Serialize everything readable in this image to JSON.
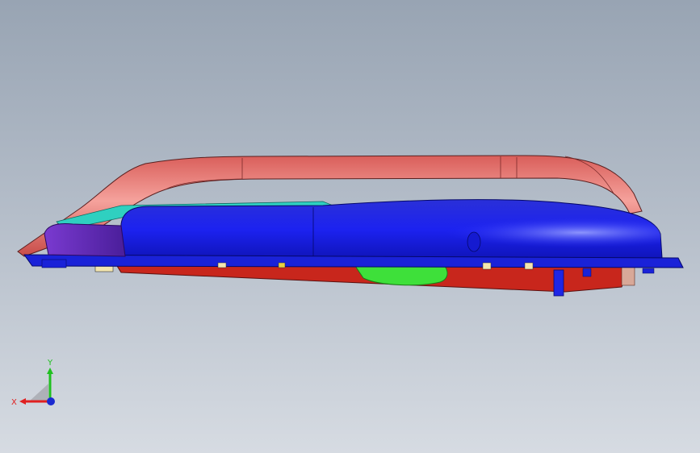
{
  "viewport": {
    "background_top": "#98a4b3",
    "background_bottom": "#d6dbe2"
  },
  "model": {
    "handle_color": "#e46f6a",
    "housing_color": "#1f26e6",
    "base_plate_color": "#c8261c",
    "inner_part_color": "#3ee03a",
    "end_cap_color": "#6a2fb8",
    "seal_color": "#2fd0c0"
  },
  "triad": {
    "x_label": "X",
    "y_label": "Y",
    "x_color": "#e02020",
    "y_color": "#20c020",
    "z_color": "#1a2ad0"
  }
}
